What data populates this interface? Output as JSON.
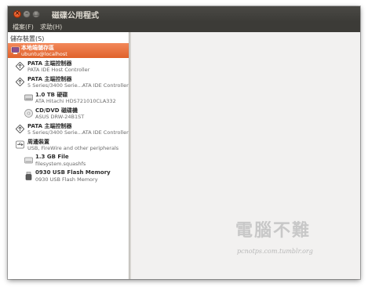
{
  "window": {
    "title": "磁碟公用程式",
    "close_glyph": "×",
    "min_glyph": "–",
    "max_glyph": "□"
  },
  "menu": {
    "file": "檔案(F)",
    "help": "求助(H)"
  },
  "sidebar": {
    "header": "儲存裝置(S)",
    "items": [
      {
        "name": "本地端儲存區",
        "desc": "ubuntu@localhost",
        "icon": "computer-icon",
        "selected": true
      },
      {
        "name": "PATA 主端控制器",
        "desc": "PATA IDE Host Controller",
        "icon": "controller-icon"
      },
      {
        "name": "PATA 主端控制器",
        "desc": "5 Series/3400 Serie...ATA IDE Controller",
        "icon": "controller-icon"
      },
      {
        "name": "1.0 TB 硬碟",
        "desc": "ATA Hitachi HDS721010CLA332",
        "icon": "hard-disk-icon"
      },
      {
        "name": "CD/DVD 磁碟機",
        "desc": "ASUS DRW-24B1ST",
        "icon": "optical-drive-icon"
      },
      {
        "name": "PATA 主端控制器",
        "desc": "5 Series/3400 Serie...ATA IDE Controller",
        "icon": "controller-icon"
      },
      {
        "name": "周邊裝置",
        "desc": "USB, FireWire and other peripherals",
        "icon": "usb-icon"
      },
      {
        "name": "1.3 GB File",
        "desc": "filesystem.squashfs",
        "icon": "file-disk-icon"
      },
      {
        "name": "0930 USB Flash Memory",
        "desc": "0930 USB Flash Memory",
        "icon": "usb-flash-icon"
      }
    ]
  },
  "watermark": {
    "main": "電腦不難",
    "sub": "pcnotps.com.tumblr.org"
  }
}
